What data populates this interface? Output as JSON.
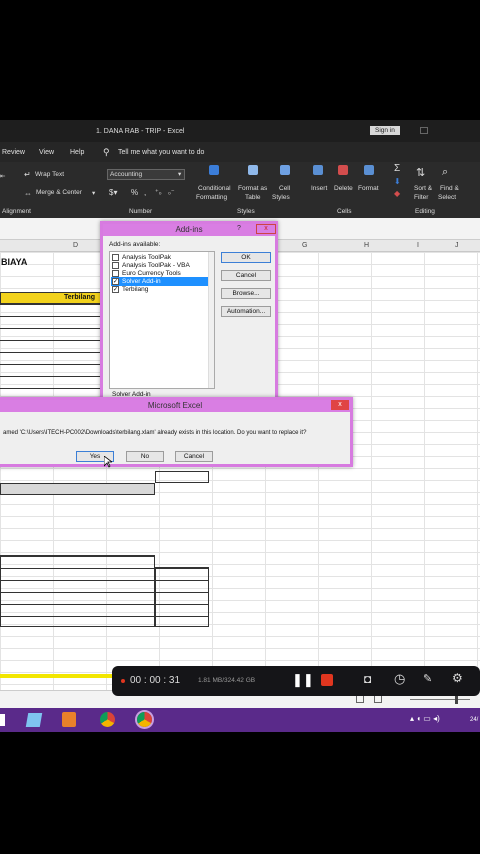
{
  "window": {
    "title": "1. DANA RAB - TRIP  -  Excel",
    "signin": "Sign in"
  },
  "menu": {
    "review": "Review",
    "view": "View",
    "help": "Help",
    "tellme": "Tell me what you want to do"
  },
  "ribbon": {
    "wrap_text": "Wrap Text",
    "merge_center": "Merge & Center",
    "number_format": "Accounting",
    "conditional": "Conditional",
    "formatting": "Formatting",
    "format_as": "Format as",
    "table": "Table",
    "cell": "Cell",
    "styles_btn": "Styles",
    "insert": "Insert",
    "delete": "Delete",
    "format": "Format",
    "sort": "Sort &",
    "filter": "Filter",
    "find": "Find &",
    "select": "Select",
    "group_alignment": "Alignment",
    "group_number": "Number",
    "group_styles": "Styles",
    "group_cells": "Cells",
    "group_editing": "Editing"
  },
  "columns": {
    "d": "D",
    "g": "G",
    "h": "H",
    "i": "I",
    "j": "J"
  },
  "sheet": {
    "biaya": "BIAYA",
    "terbilang_header": "Terbilang"
  },
  "addins": {
    "title": "Add-ins",
    "help": "?",
    "available": "Add-ins available:",
    "items": [
      {
        "label": "Analysis ToolPak",
        "checked": false
      },
      {
        "label": "Analysis ToolPak - VBA",
        "checked": false
      },
      {
        "label": "Euro Currency Tools",
        "checked": false
      },
      {
        "label": "Solver Add-in",
        "checked": true
      },
      {
        "label": "Terbilang",
        "checked": true
      }
    ],
    "ok": "OK",
    "cancel": "Cancel",
    "browse": "Browse...",
    "automation": "Automation...",
    "desc": "Solver Add-in"
  },
  "msgbox": {
    "title": "Microsoft Excel",
    "text": "amed 'C:\\Users\\ITECH-PC002\\Downloads\\terbilang.xlam' already exists in this location. Do you want to replace it?",
    "yes": "Yes",
    "no": "No",
    "cancel": "Cancel"
  },
  "recorder": {
    "time": "00 : 00 : 31",
    "size": "1.81 MB/324.42 GB"
  },
  "tray": {
    "date": "24/"
  },
  "colors": {
    "accent": "#d97ee3",
    "header_yellow": "#f2d21c",
    "taskbar": "#5a2a8a",
    "record": "#e0361f"
  }
}
